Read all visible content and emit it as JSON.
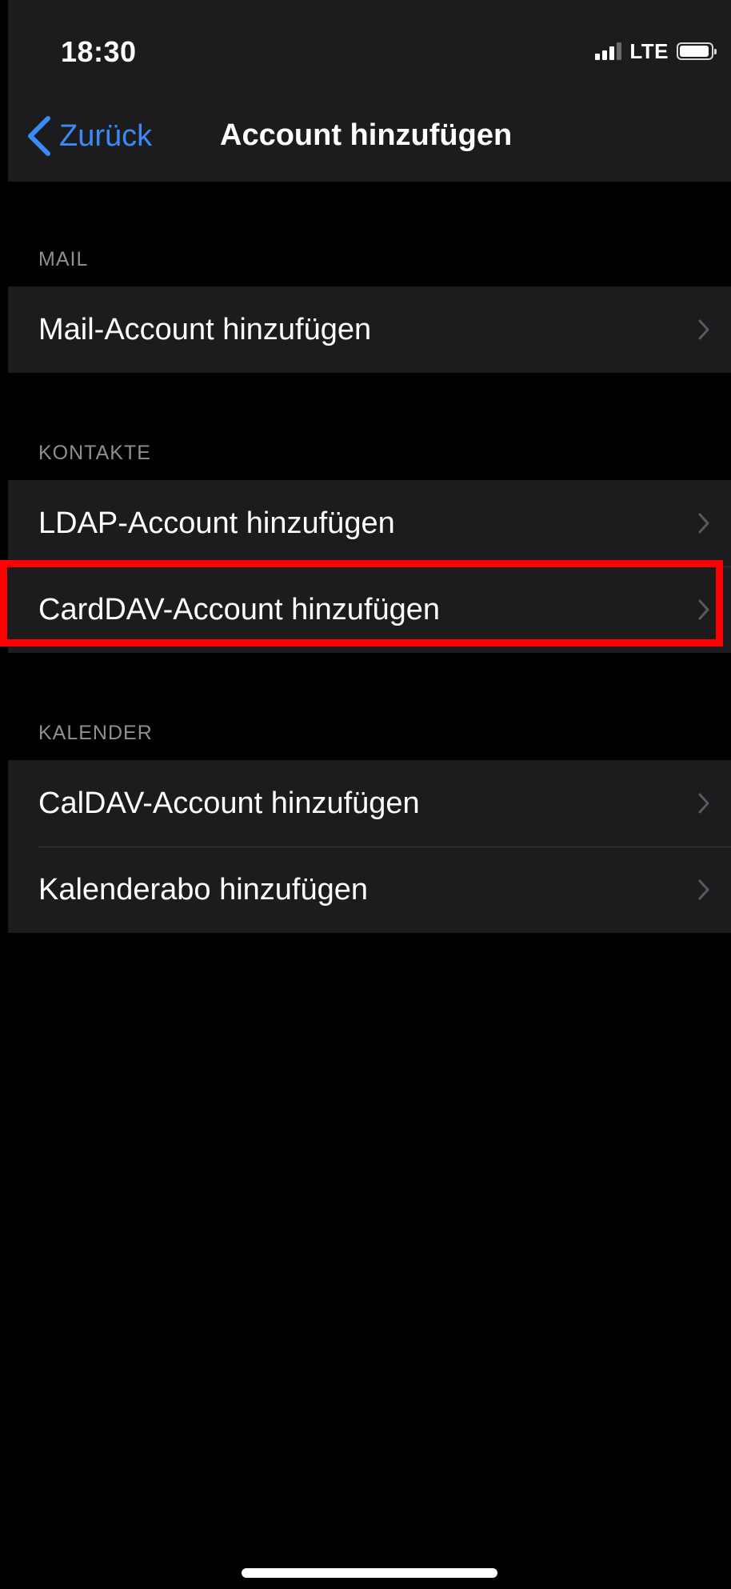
{
  "status_bar": {
    "time": "18:30",
    "network": "LTE",
    "signal_bars_active": 3,
    "signal_bars_total": 4
  },
  "nav": {
    "back_label": "Zurück",
    "title": "Account hinzufügen",
    "back_icon": "chevron-left-icon"
  },
  "sections": {
    "mail": {
      "header": "MAIL",
      "items": [
        {
          "label": "Mail-Account hinzufügen"
        }
      ]
    },
    "contacts": {
      "header": "KONTAKTE",
      "items": [
        {
          "label": "LDAP-Account hinzufügen"
        },
        {
          "label": "CardDAV-Account hinzufügen"
        }
      ]
    },
    "calendar": {
      "header": "KALENDER",
      "items": [
        {
          "label": "CalDAV-Account hinzufügen"
        },
        {
          "label": "Kalenderabo hinzufügen"
        }
      ]
    }
  },
  "colors": {
    "background": "#000000",
    "cell_background": "#1c1c1e",
    "accent": "#3a8bf5",
    "secondary_text": "#8e8e93",
    "highlight": "#ff0000"
  }
}
